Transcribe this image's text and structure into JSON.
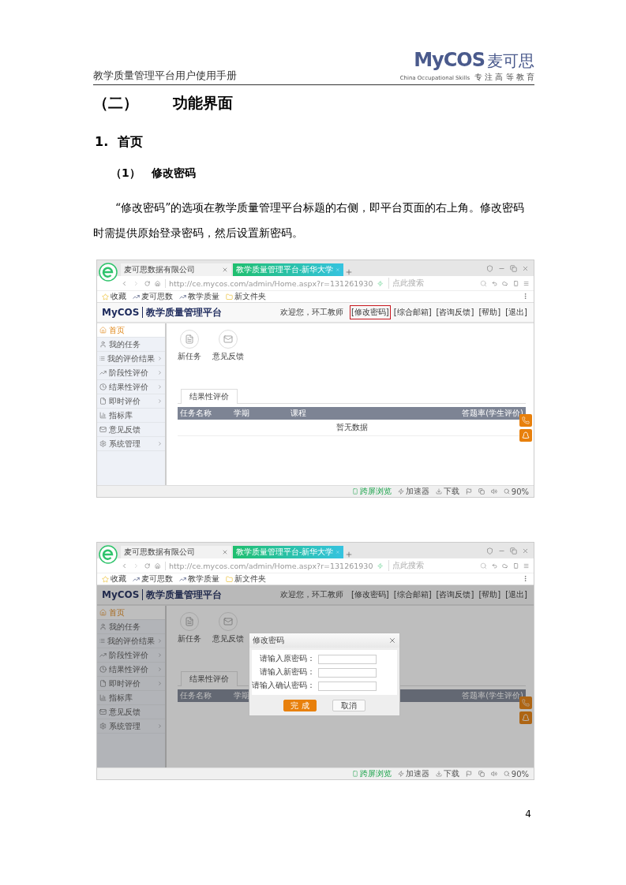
{
  "header": {
    "title": "教学质量管理平台用户使用手册",
    "logo": "MyCOS",
    "logo_cn": "麦可思",
    "tagline": "China Occupational Skills",
    "motto": "专 注 高 等 教 育"
  },
  "section_heading": {
    "number": "（二）",
    "title": "功能界面"
  },
  "heading_1": {
    "number": "1.",
    "title": "首页"
  },
  "heading_2": {
    "number": "（1）",
    "title": "修改密码"
  },
  "paragraph": "“修改密码”的选项在教学质量管理平台标题的右侧，即平台页面的右上角。修改密码时需提供原始登录密码，然后设置新密码。",
  "screenshots": [
    {
      "tabs": [
        {
          "label": "麦可思数据有限公司",
          "selected": false
        },
        {
          "label": "教学质量管理平台-新华大学",
          "selected": true
        }
      ],
      "url": "http://ce.mycos.com/admin/Home.aspx?r=131261930",
      "search_placeholder": "点此搜索",
      "bookmarks": [
        {
          "label": "收藏",
          "kind": "star"
        },
        {
          "label": "麦可思数",
          "kind": "logo"
        },
        {
          "label": "教学质量",
          "kind": "logo"
        },
        {
          "label": "新文件夹",
          "kind": "folder"
        }
      ],
      "app_logo": "MyCOS",
      "app_title": "教学质量管理平台",
      "welcome": "欢迎您，环工教师",
      "links": [
        {
          "label": "[修改密码]",
          "highlighted": true
        },
        {
          "label": "[综合邮箱]",
          "highlighted": false
        },
        {
          "label": "[咨询反馈]",
          "highlighted": false
        },
        {
          "label": "[帮助]",
          "highlighted": false
        },
        {
          "label": "[退出]",
          "highlighted": false
        }
      ],
      "sidebar": [
        {
          "label": "首页",
          "kind": "home",
          "selected": true,
          "has_submenu": false
        },
        {
          "label": "我的任务",
          "kind": "user",
          "selected": false,
          "has_submenu": false
        },
        {
          "label": "我的评价结果",
          "kind": "list",
          "selected": false,
          "has_submenu": true
        },
        {
          "label": "阶段性评价",
          "kind": "chart",
          "selected": false,
          "has_submenu": true
        },
        {
          "label": "结果性评价",
          "kind": "clock",
          "selected": false,
          "has_submenu": true
        },
        {
          "label": "即时评价",
          "kind": "file",
          "selected": false,
          "has_submenu": true
        },
        {
          "label": "指标库",
          "kind": "bar",
          "selected": false,
          "has_submenu": false
        },
        {
          "label": "意见反馈",
          "kind": "mail",
          "selected": false,
          "has_submenu": false
        },
        {
          "label": "系统管理",
          "kind": "settings",
          "selected": false,
          "has_submenu": true
        }
      ],
      "shortcuts": [
        {
          "label": "新任务",
          "kind": "document"
        },
        {
          "label": "意见反馈",
          "kind": "mail"
        }
      ],
      "content_tab": "结果性评价",
      "columns": [
        "任务名称",
        "学期",
        "课程",
        "答题率(学生评价)"
      ],
      "empty_text": "暂无数据",
      "status": [
        {
          "label": "跨屏浏览",
          "kind": "mobile"
        },
        {
          "label": "加速器",
          "kind": "accelerator"
        },
        {
          "label": "下载",
          "kind": "download"
        }
      ],
      "zoom": "90%"
    },
    {
      "tabs": [
        {
          "label": "麦可思数据有限公司",
          "selected": false
        },
        {
          "label": "教学质量管理平台-新华大学",
          "selected": true
        }
      ],
      "url": "http://ce.mycos.com/admin/Home.aspx?r=131261930",
      "search_placeholder": "点此搜索",
      "bookmarks": [
        {
          "label": "收藏",
          "kind": "star"
        },
        {
          "label": "麦可思数",
          "kind": "logo"
        },
        {
          "label": "教学质量",
          "kind": "logo"
        },
        {
          "label": "新文件夹",
          "kind": "folder"
        }
      ],
      "app_logo": "MyCOS",
      "app_title": "教学质量管理平台",
      "welcome": "欢迎您，环工教师",
      "links": [
        {
          "label": "[修改密码]",
          "highlighted": false
        },
        {
          "label": "[综合邮箱]",
          "highlighted": false
        },
        {
          "label": "[咨询反馈]",
          "highlighted": false
        },
        {
          "label": "[帮助]",
          "highlighted": false
        },
        {
          "label": "[退出]",
          "highlighted": false
        }
      ],
      "sidebar": [
        {
          "label": "首页",
          "kind": "home",
          "selected": true,
          "has_submenu": false
        },
        {
          "label": "我的任务",
          "kind": "user",
          "selected": false,
          "has_submenu": false
        },
        {
          "label": "我的评价结果",
          "kind": "list",
          "selected": false,
          "has_submenu": true
        },
        {
          "label": "阶段性评价",
          "kind": "chart",
          "selected": false,
          "has_submenu": true
        },
        {
          "label": "结果性评价",
          "kind": "clock",
          "selected": false,
          "has_submenu": true
        },
        {
          "label": "即时评价",
          "kind": "file",
          "selected": false,
          "has_submenu": true
        },
        {
          "label": "指标库",
          "kind": "bar",
          "selected": false,
          "has_submenu": false
        },
        {
          "label": "意见反馈",
          "kind": "mail",
          "selected": false,
          "has_submenu": false
        },
        {
          "label": "系统管理",
          "kind": "settings",
          "selected": false,
          "has_submenu": true
        }
      ],
      "shortcuts": [
        {
          "label": "新任务",
          "kind": "document"
        },
        {
          "label": "意见反馈",
          "kind": "mail"
        }
      ],
      "content_tab": "结果性评价",
      "columns": [
        "任务名称",
        "学期",
        "答题率(学生评价)"
      ],
      "status": [
        {
          "label": "跨屏浏览",
          "kind": "mobile"
        },
        {
          "label": "加速器",
          "kind": "accelerator"
        },
        {
          "label": "下载",
          "kind": "download"
        }
      ],
      "zoom": "90%",
      "dialog": {
        "title": "修改密码",
        "fields": [
          "请输入原密码：",
          "请输入新密码：",
          "请输入确认密码："
        ],
        "buttons": [
          {
            "label": "完 成",
            "primary": true
          },
          {
            "label": "取消",
            "primary": false
          }
        ]
      }
    }
  ],
  "page_number": "4"
}
